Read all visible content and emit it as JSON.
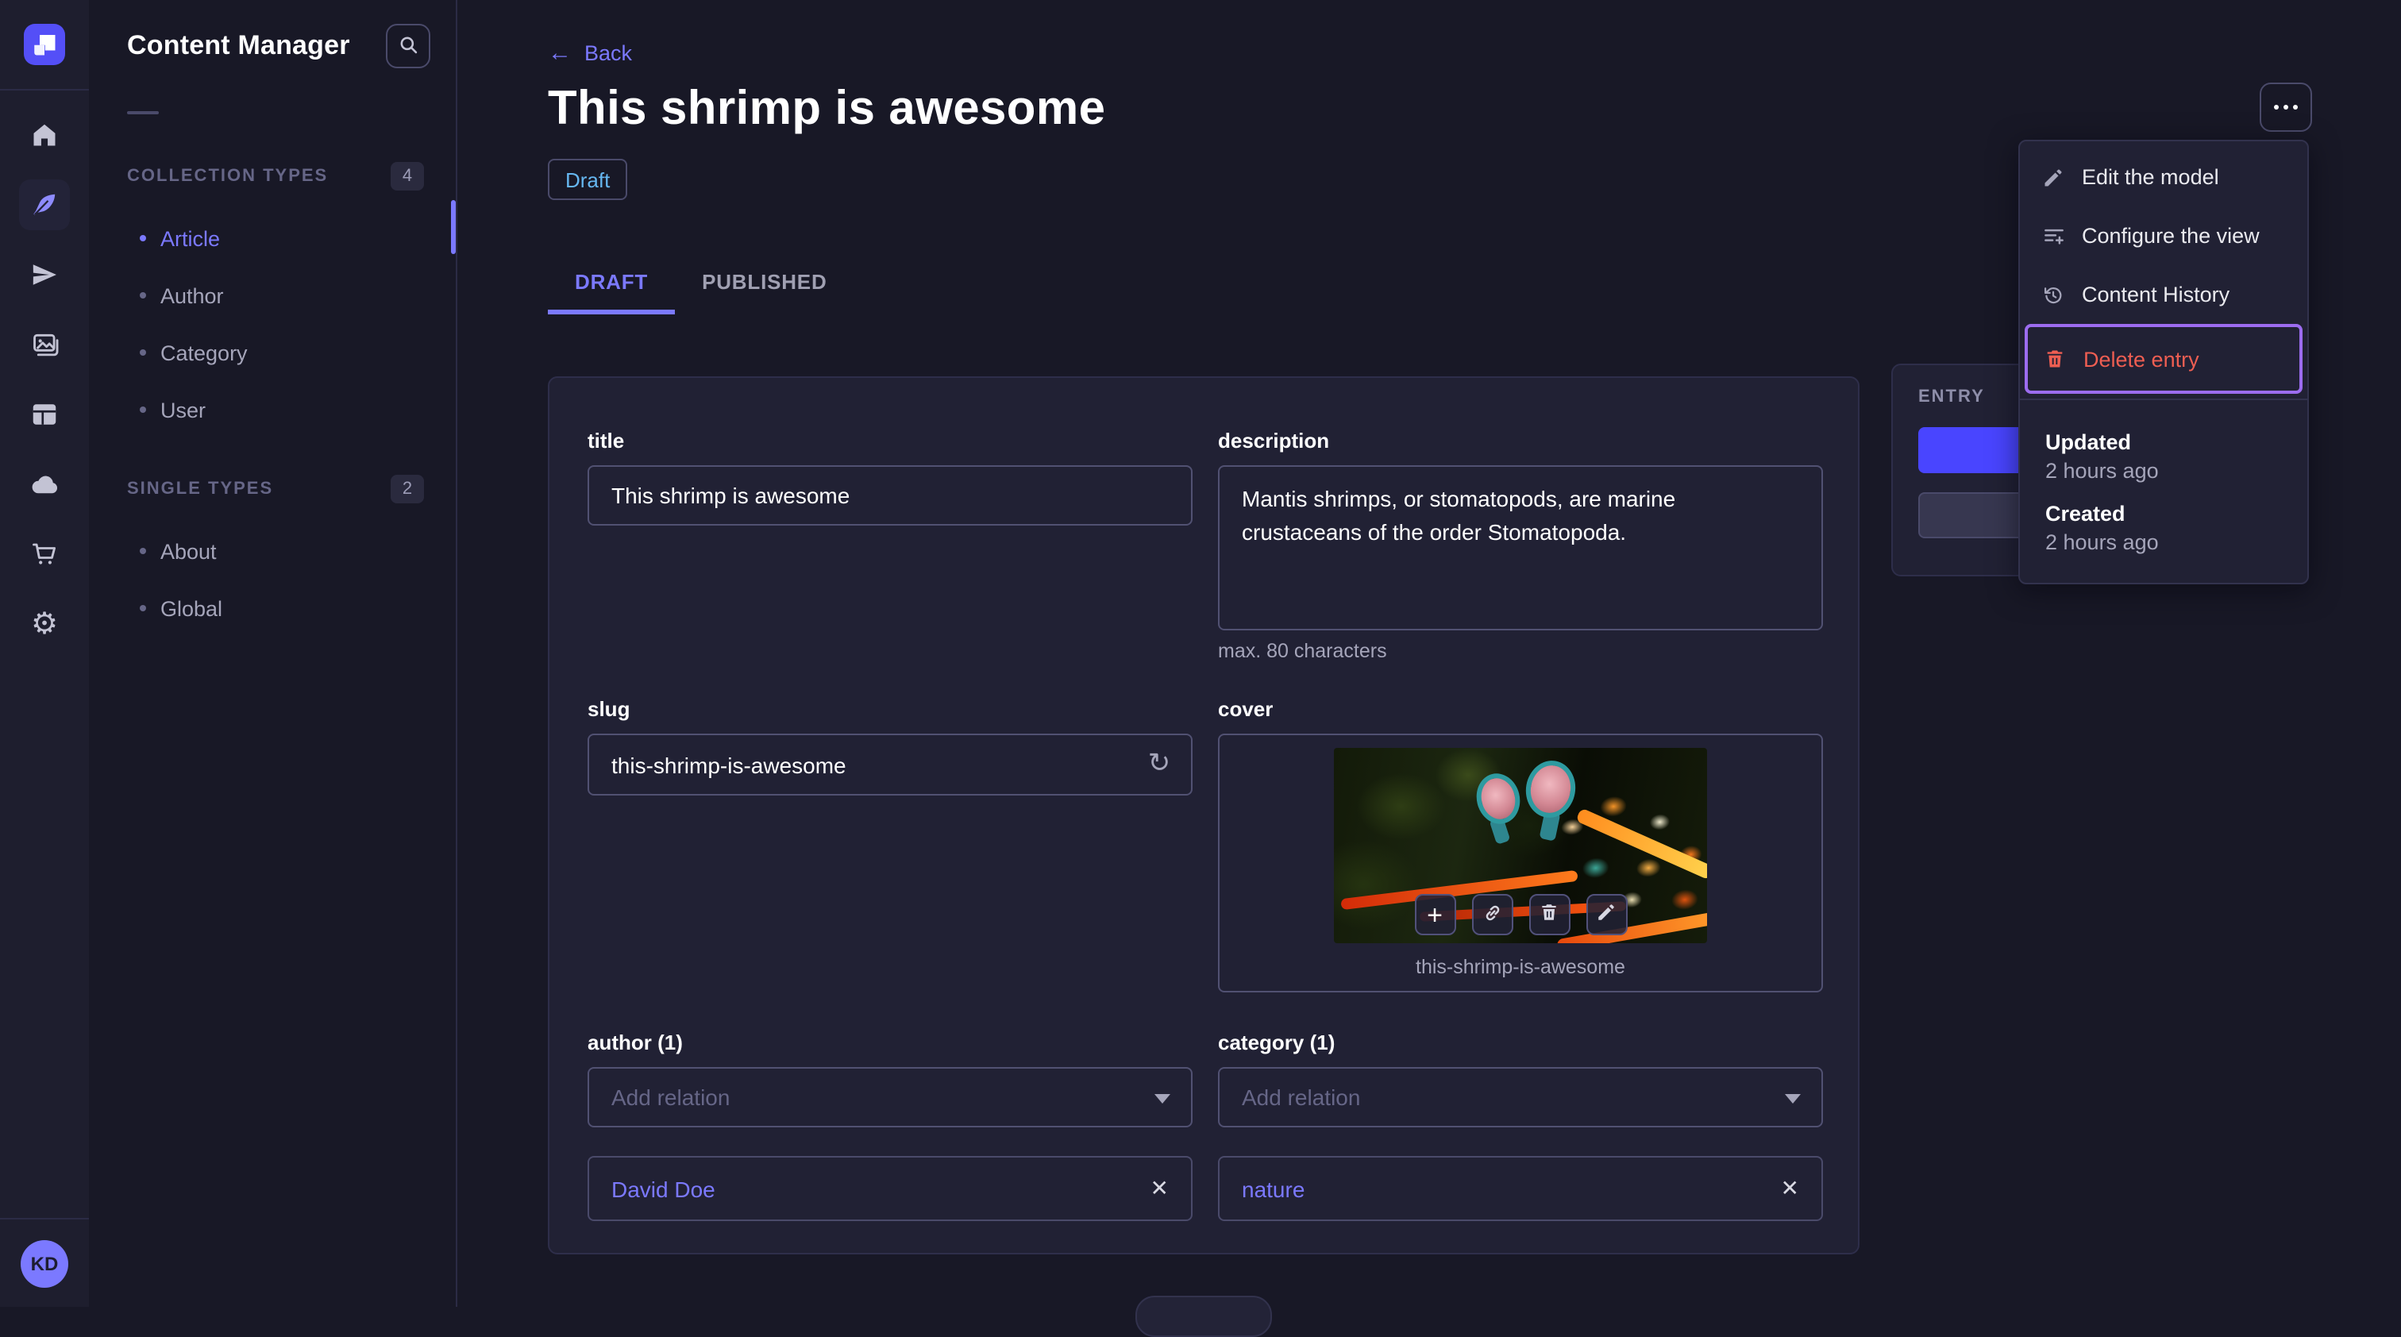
{
  "colors": {
    "accent": "#7b79ff",
    "primary_button": "#4945ff",
    "danger": "#ee5e52",
    "draft_text": "#66b7f1",
    "focus_ring": "#9c6cf0",
    "app_background": "#181826",
    "card_background": "#212134"
  },
  "nav": {
    "icons": [
      "strapi-logo",
      "home",
      "content-feather",
      "paper-plane",
      "media-images",
      "builder-layout",
      "cloud",
      "marketplace-cart",
      "settings-gear"
    ],
    "user_initials": "KD"
  },
  "subnav": {
    "title": "Content Manager",
    "search_icon": "magnifier",
    "sections": [
      {
        "label": "COLLECTION TYPES",
        "count": "4",
        "items": [
          {
            "label": "Article",
            "active": true
          },
          {
            "label": "Author"
          },
          {
            "label": "Category"
          },
          {
            "label": "User"
          }
        ]
      },
      {
        "label": "SINGLE TYPES",
        "count": "2",
        "items": [
          {
            "label": "About"
          },
          {
            "label": "Global"
          }
        ]
      }
    ]
  },
  "header": {
    "back_label": "Back",
    "title": "This shrimp is awesome",
    "status_badge": "Draft"
  },
  "tabs": {
    "draft": "DRAFT",
    "published": "PUBLISHED"
  },
  "form": {
    "title": {
      "label": "title",
      "value": "This shrimp is awesome"
    },
    "description": {
      "label": "description",
      "value": "Mantis shrimps, or stomatopods, are marine crustaceans of the order Stomatopoda.",
      "hint": "max. 80 characters"
    },
    "slug": {
      "label": "slug",
      "value": "this-shrimp-is-awesome",
      "regen_icon": "refresh"
    },
    "cover": {
      "label": "cover",
      "filename": "this-shrimp-is-awesome",
      "action_icons": [
        "plus",
        "link",
        "trash",
        "pencil"
      ]
    },
    "author": {
      "label": "author (1)",
      "placeholder": "Add relation",
      "relation": "David Doe"
    },
    "category": {
      "label": "category (1)",
      "placeholder": "Add relation",
      "relation": "nature"
    }
  },
  "entry_panel": {
    "title": "ENTRY"
  },
  "context_menu": {
    "items": [
      {
        "label": "Edit the model",
        "icon": "pencil"
      },
      {
        "label": "Configure the view",
        "icon": "list-plus"
      },
      {
        "label": "Content History",
        "icon": "history"
      },
      {
        "label": "Delete entry",
        "icon": "trash",
        "danger": true
      }
    ],
    "updated_label": "Updated",
    "updated_value": "2 hours ago",
    "created_label": "Created",
    "created_value": "2 hours ago"
  }
}
